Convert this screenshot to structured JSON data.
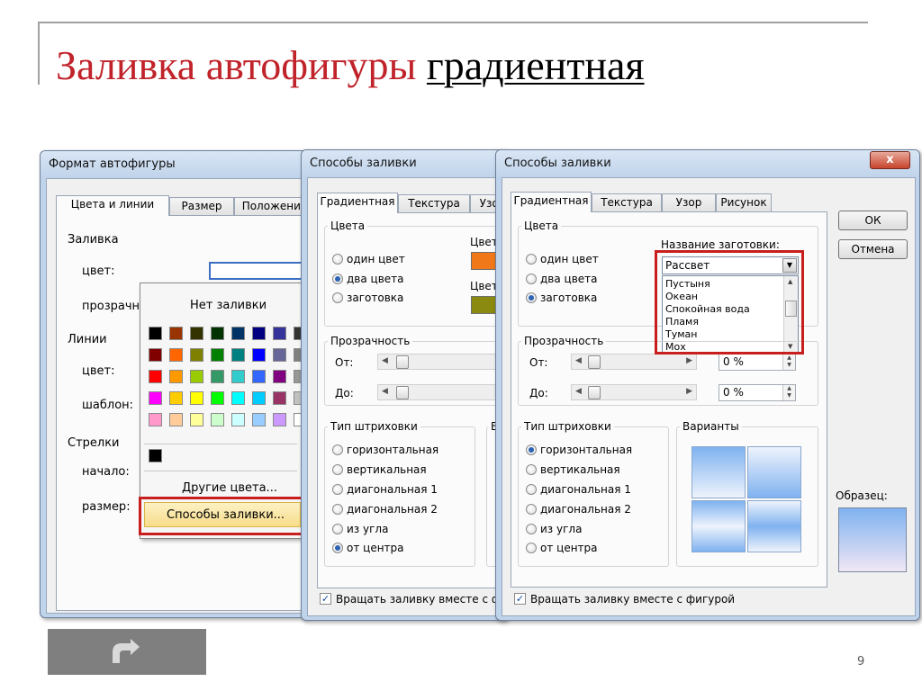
{
  "slide": {
    "title_part1": "Заливка автофигуры",
    "title_part2": "градиентная",
    "page_number": "9"
  },
  "dialog_format": {
    "title": "Формат автофигуры",
    "tabs": [
      "Цвета и линии",
      "Размер",
      "Положение"
    ],
    "fill_section": "Заливка",
    "color_label": "цвет:",
    "transparency_label": "прозрачность:",
    "lines_section": "Линии",
    "line_color_label": "цвет:",
    "pattern_label": "шаблон:",
    "arrows_section": "Стрелки",
    "start_label": "начало:",
    "size_label": "размер:"
  },
  "color_popup": {
    "no_fill": "Нет заливки",
    "other_colors": "Другие цвета...",
    "fill_effects": "Способы заливки...",
    "colors": [
      [
        "#000000",
        "#993300",
        "#333300",
        "#003300",
        "#003366",
        "#000080",
        "#333399",
        "#333333"
      ],
      [
        "#800000",
        "#ff6600",
        "#808000",
        "#008000",
        "#008080",
        "#0000ff",
        "#666699",
        "#808080"
      ],
      [
        "#ff0000",
        "#ff9900",
        "#99cc00",
        "#339966",
        "#33cccc",
        "#3366ff",
        "#800080",
        "#969696"
      ],
      [
        "#ff00ff",
        "#ffcc00",
        "#ffff00",
        "#00ff00",
        "#00ffff",
        "#00ccff",
        "#993366",
        "#c0c0c0"
      ],
      [
        "#ff99cc",
        "#ffcc99",
        "#ffff99",
        "#ccffcc",
        "#ccffff",
        "#99ccff",
        "#cc99ff",
        "#ffffff"
      ]
    ],
    "recent_color": "#000000"
  },
  "dialog_fill_1": {
    "title": "Способы заливки",
    "tabs": [
      "Градиентная",
      "Текстура",
      "Узор"
    ],
    "colors_group": "Цвета",
    "radio_one_color": "один цвет",
    "radio_two_colors": "два цвета",
    "radio_preset": "заготовка",
    "color1_label": "Цвет",
    "color2_label": "Цвет",
    "color1_value": "#f07818",
    "color2_value": "#8a8a10",
    "transparency_group": "Прозрачность",
    "from_label": "От:",
    "to_label": "До:",
    "shading_group": "Тип штриховки",
    "shading_options": [
      "горизонтальная",
      "вертикальная",
      "диагональная 1",
      "диагональная 2",
      "из угла",
      "от центра"
    ],
    "variants_cut": "В",
    "rotate_label": "Вращать заливку вместе с фигурой"
  },
  "dialog_fill_2": {
    "title": "Способы заливки",
    "tabs": [
      "Градиентная",
      "Текстура",
      "Узор",
      "Рисунок"
    ],
    "colors_group": "Цвета",
    "radio_one_color": "один цвет",
    "radio_two_colors": "два цвета",
    "radio_preset": "заготовка",
    "preset_name_label": "Название заготовки:",
    "preset_selected": "Рассвет",
    "preset_list": [
      "Пустыня",
      "Океан",
      "Спокойная вода",
      "Пламя",
      "Туман",
      "Мох"
    ],
    "transparency_group": "Прозрачность",
    "from_label": "От:",
    "to_label": "До:",
    "from_value": "0 %",
    "to_value": "0 %",
    "shading_group": "Тип штриховки",
    "shading_options": [
      "горизонтальная",
      "вертикальная",
      "диагональная 1",
      "диагональная 2",
      "из угла",
      "от центра"
    ],
    "variants_group": "Варианты",
    "sample_label": "Образец:",
    "ok": "ОК",
    "cancel": "Отмена",
    "close": "x",
    "rotate_label": "Вращать заливку вместе с фигурой"
  }
}
